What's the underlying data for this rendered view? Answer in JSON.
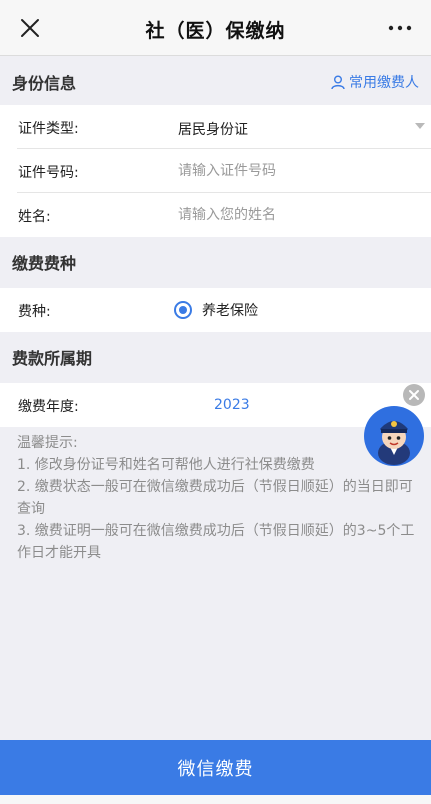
{
  "nav": {
    "title": "社（医）保缴纳",
    "close_icon": "close-icon",
    "more_icon": "more-icon"
  },
  "identity_section": {
    "title": "身份信息",
    "common_payer_label": "常用缴费人"
  },
  "identity_rows": {
    "id_type": {
      "label": "证件类型:",
      "value": "居民身份证"
    },
    "id_number": {
      "label": "证件号码:",
      "placeholder": "请输入证件号码"
    },
    "name": {
      "label": "姓名:",
      "placeholder": "请输入您的姓名"
    }
  },
  "fee_type_section": {
    "title": "缴费费种"
  },
  "fee_type_row": {
    "label": "费种:",
    "option": "养老保险",
    "selected": true
  },
  "period_section": {
    "title": "费款所属期"
  },
  "period_row": {
    "label": "缴费年度:",
    "value": "2023"
  },
  "tips": {
    "title": "温馨提示:",
    "items": [
      "1. 修改身份证号和姓名可帮他人进行社保费缴费",
      "2. 缴费状态一般可在微信缴费成功后（节假日顺延）的当日即可查询",
      "3. 缴费证明一般可在微信缴费成功后（节假日顺延）的3~5个工作日才能开具"
    ]
  },
  "pay_button": {
    "label": "微信缴费"
  },
  "colors": {
    "accent": "#3a7be5",
    "background": "#efeff4",
    "nav_bg": "#f7f7f7"
  }
}
